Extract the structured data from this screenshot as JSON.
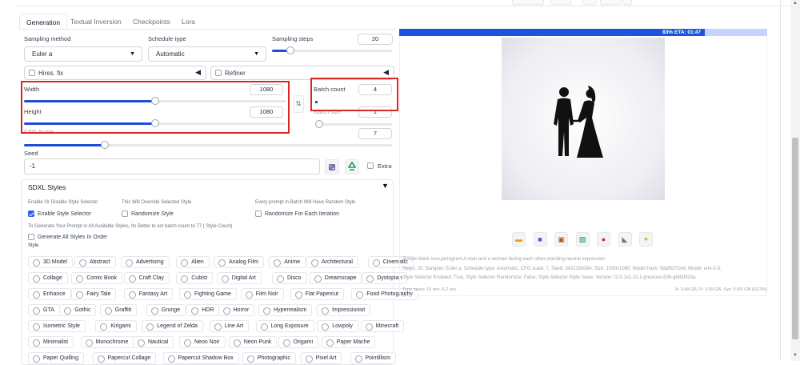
{
  "tabs": [
    "Generation",
    "Textual Inversion",
    "Checkpoints",
    "Lora"
  ],
  "sampling_method": {
    "label": "Sampling method",
    "value": "Euler a"
  },
  "schedule_type": {
    "label": "Schedule type",
    "value": "Automatic"
  },
  "sampling_steps": {
    "label": "Sampling steps",
    "value": "20",
    "fraction": 0.15
  },
  "hires_fix": {
    "label": "Hires. fix",
    "checked": false
  },
  "refiner": {
    "label": "Refiner",
    "checked": false
  },
  "width": {
    "label": "Width",
    "value": "1080",
    "fraction": 0.5
  },
  "height": {
    "label": "Height",
    "value": "1080",
    "fraction": 0.5
  },
  "batch_count": {
    "label": "Batch count",
    "value": "4"
  },
  "batch_size": {
    "label": "Batch size",
    "value": "1"
  },
  "cfg_scale": {
    "label": "CFG Scale",
    "value": "7",
    "fraction": 0.22
  },
  "seed": {
    "label": "Seed",
    "value": "-1"
  },
  "extra": {
    "label": "Extra",
    "checked": false
  },
  "icons": {
    "swap": "swap-arrows-icon",
    "dice": "dice-icon",
    "recycle": "recycle-icon",
    "collapse": "triangle-left-icon"
  },
  "sdxl": {
    "title": "SDXL Styles",
    "hint1": "Enable Or Disable Style Selector",
    "hint2": "This Will Override Selected Style",
    "hint3": "Every prompt in Batch Will Have Random Style",
    "enable_label": "Enable Style Selector",
    "enable_checked": true,
    "randomize_label": "Randomize Style",
    "randomize_each_label": "Randomize For Each Iteration",
    "hint4": "To Generate Your Prompt in All Available Styles, Its Better to set batch count to 77 ( Style Count)",
    "generate_all_label": "Generate All Styles In Order",
    "style_label": "Style",
    "styles": [
      [
        "3D Model",
        "Abstract",
        "Advertising",
        "Alien",
        "Analog Film",
        "Anime",
        "Architectural",
        "Cinematic"
      ],
      [
        "Collage",
        "Comic Book",
        "Craft Clay",
        "Cubist",
        "Digital Art",
        "Disco",
        "Dreamscape",
        "Dystopian"
      ],
      [
        "Enhance",
        "Fairy Tale",
        "Fantasy Art",
        "Fighting Game",
        "Film Noir",
        "Flat Papercut",
        "Food Photography"
      ],
      [
        "GTA",
        "Gothic",
        "Graffiti",
        "Grunge",
        "HDR",
        "Horror",
        "Hyperrealism",
        "Impressionist"
      ],
      [
        "Isometric Style",
        "Kirigami",
        "Legend of Zelda",
        "Line Art",
        "Long Exposure",
        "Lowpoly",
        "Minecraft"
      ],
      [
        "Minimalist",
        "Monochrome",
        "Nautical",
        "Neon Noir",
        "Neon Punk",
        "Origami",
        "Paper Mache"
      ],
      [
        "Paper Quilling",
        "Papercut Collage",
        "Papercut Shadow Box",
        "Photographic",
        "Pixel Art",
        "Pointillism"
      ]
    ]
  },
  "progress": {
    "text": "83% ETA: 01:47",
    "fraction": 0.83,
    "color": "#1a56db"
  },
  "image_toolbar": [
    "folder-icon",
    "save-icon",
    "zip-icon",
    "image-icon",
    "palette-icon",
    "ruler-icon",
    "sparkle-icon"
  ],
  "output": {
    "prompt": "Simple  black  icon,pictogram,A man and a woman facing each other,standing,neutral expression",
    "params": "Steps: 20, Sampler: Euler a, Schedule type: Automatic, CFG scale: 7, Seed: 3431193084, Size: 1080x1080, Model hash: 9daf5272e6, Model: emi-2-5,",
    "params2": "Style Selector Enabled: True, Style Selector Randomize: False, Style Selector Style: base, Version: f2.0.1v1.10.1-previous-636-gb835f24a",
    "time": "Time taken: 10 min. 6.2 sec.",
    "mem": "A: 3.48 GB, R: 3.89 GB, Sys: 5.0/6 GB (83.3%)"
  },
  "colors": {
    "accent": "#1d4ed8",
    "highlight": "#dc2626"
  }
}
